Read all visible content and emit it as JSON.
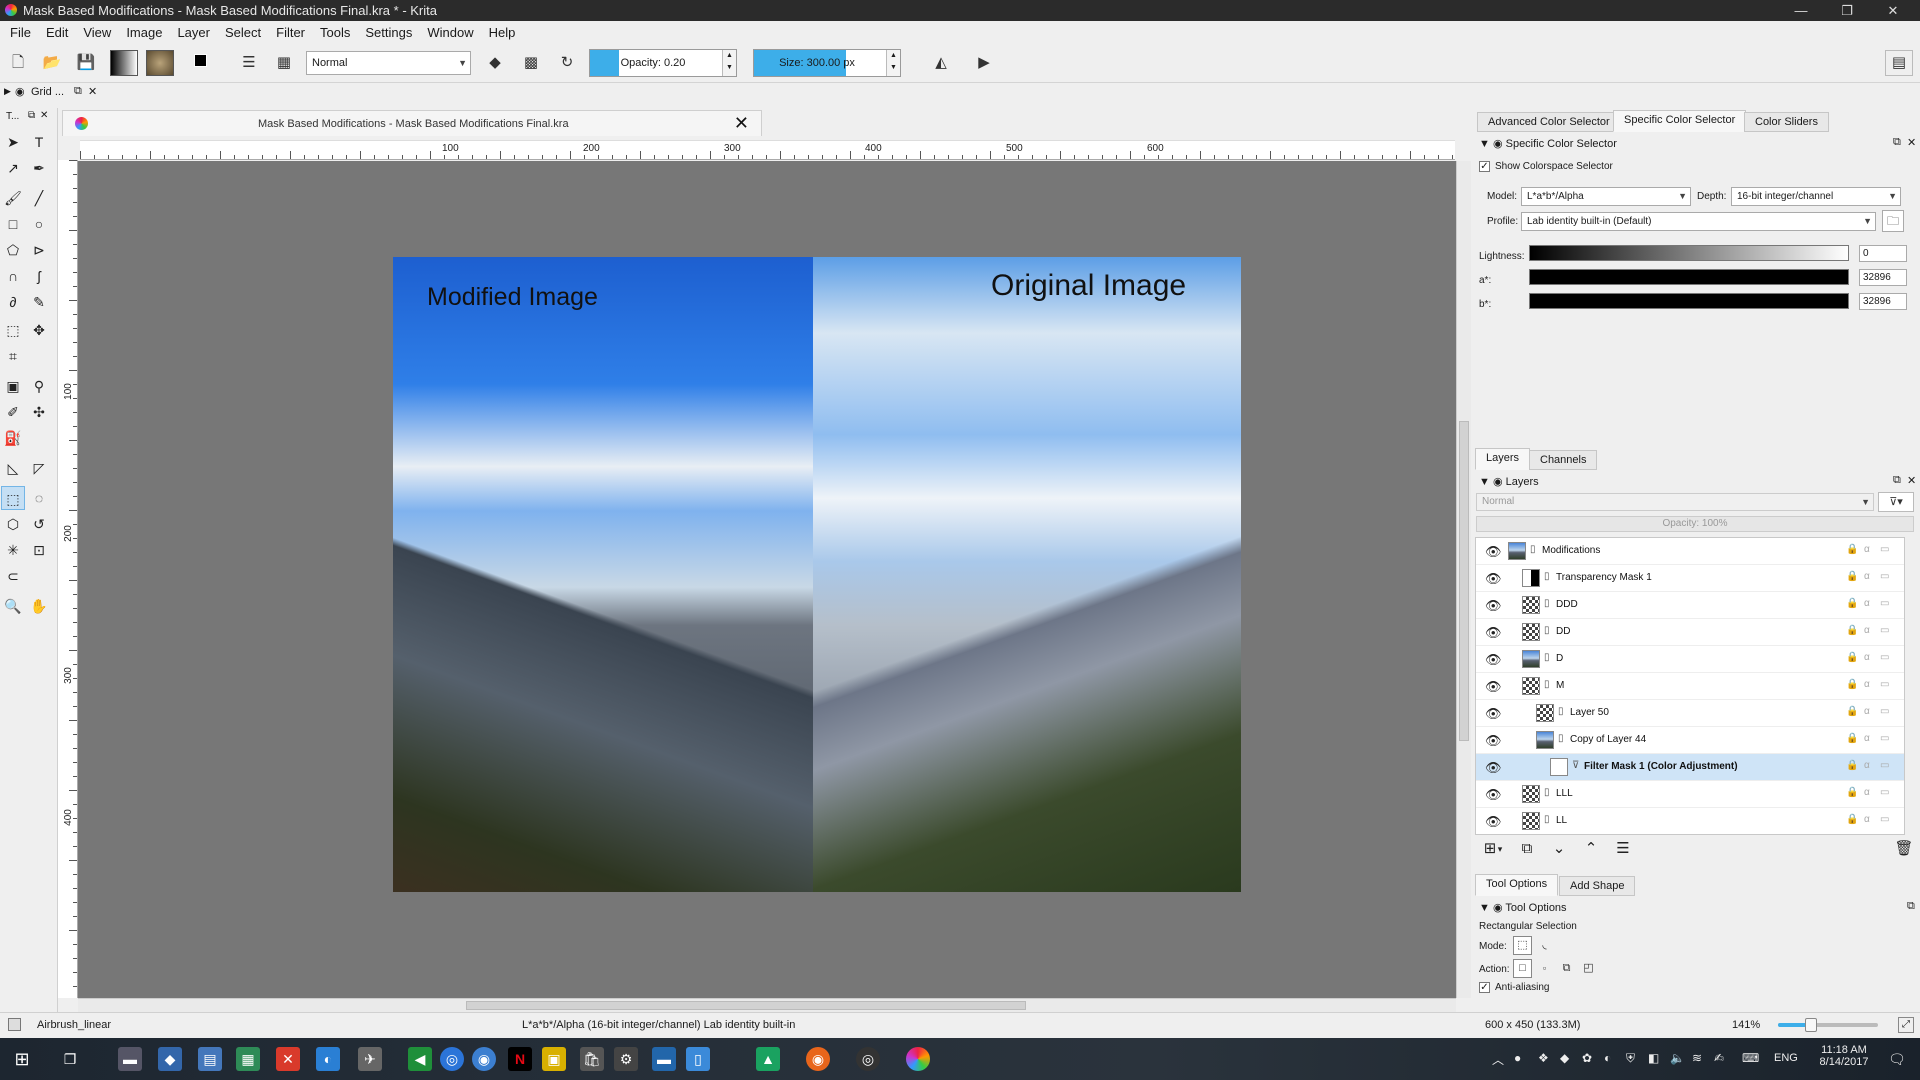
{
  "titlebar": {
    "title": "Mask Based Modifications - Mask Based Modifications Final.kra * - Krita",
    "minimize": "—",
    "maximize": "❐",
    "close": "✕"
  },
  "menu": [
    "File",
    "Edit",
    "View",
    "Image",
    "Layer",
    "Select",
    "Filter",
    "Tools",
    "Settings",
    "Window",
    "Help"
  ],
  "toolbar": {
    "blend_mode": "Normal",
    "opacity_label": "Opacity:  0.20",
    "opacity_fraction": 0.2,
    "size_label": "Size:  300.00 px",
    "size_fill_fraction": 0.63
  },
  "grid_dock": {
    "title": "Grid ..."
  },
  "toolbox": {
    "title": "T..."
  },
  "document": {
    "tab_title": "Mask Based Modifications - Mask Based Modifications Final.kra",
    "ruler_h_ticks": [
      "100",
      "200",
      "300",
      "400",
      "500",
      "600"
    ],
    "ruler_v_ticks": [
      "100",
      "200",
      "300",
      "400"
    ],
    "image_label_left": "Modified Image",
    "image_label_right": "Original Image"
  },
  "color_panel": {
    "tabs": [
      "Advanced Color Selector",
      "Specific Color Selector",
      "Color Sliders"
    ],
    "active_tab": "Specific Color Selector",
    "header": "Specific Color Selector",
    "show_colorspace_label": "Show Colorspace Selector",
    "model_label": "Model:",
    "model_value": "L*a*b*/Alpha",
    "depth_label": "Depth:",
    "depth_value": "16-bit integer/channel",
    "profile_label": "Profile:",
    "profile_value": "Lab identity built-in (Default)",
    "channels": [
      {
        "label": "Lightness:",
        "value": "0"
      },
      {
        "label": "a*:",
        "value": "32896"
      },
      {
        "label": "b*:",
        "value": "32896"
      }
    ]
  },
  "layers_panel": {
    "tabs": [
      "Layers",
      "Channels"
    ],
    "header": "Layers",
    "blend_mode": "Normal",
    "opacity": "Opacity:  100%",
    "layers": [
      {
        "name": "Modifications",
        "depth": 0,
        "thumb": "photo",
        "selected": false
      },
      {
        "name": "Transparency Mask 1",
        "depth": 1,
        "thumb": "mask",
        "selected": false
      },
      {
        "name": "DDD",
        "depth": 1,
        "thumb": "checker",
        "selected": false
      },
      {
        "name": "DD",
        "depth": 1,
        "thumb": "checker",
        "selected": false
      },
      {
        "name": "D",
        "depth": 1,
        "thumb": "photo",
        "selected": false
      },
      {
        "name": "M",
        "depth": 1,
        "thumb": "checker",
        "selected": false
      },
      {
        "name": "Layer 50",
        "depth": 2,
        "thumb": "checker",
        "selected": false
      },
      {
        "name": "Copy of Layer 44",
        "depth": 2,
        "thumb": "photo",
        "selected": false
      },
      {
        "name": "Filter Mask 1 (Color Adjustment)",
        "depth": 3,
        "thumb": "white",
        "selected": true
      },
      {
        "name": "LLL",
        "depth": 1,
        "thumb": "checker",
        "selected": false
      },
      {
        "name": "LL",
        "depth": 1,
        "thumb": "checker",
        "selected": false
      }
    ]
  },
  "tool_options": {
    "tabs": [
      "Tool Options",
      "Add Shape"
    ],
    "header": "Tool Options",
    "tool_name": "Rectangular Selection",
    "mode_label": "Mode:",
    "action_label": "Action:",
    "antialias_label": "Anti-aliasing"
  },
  "status": {
    "brush": "Airbrush_linear",
    "colorspace": "L*a*b*/Alpha (16-bit integer/channel)  Lab identity built-in",
    "image_size": "600 x 450 (133.3M)",
    "zoom": "141%"
  },
  "taskbar": {
    "language": "ENG",
    "time": "11:18 AM",
    "date": "8/14/2017"
  }
}
